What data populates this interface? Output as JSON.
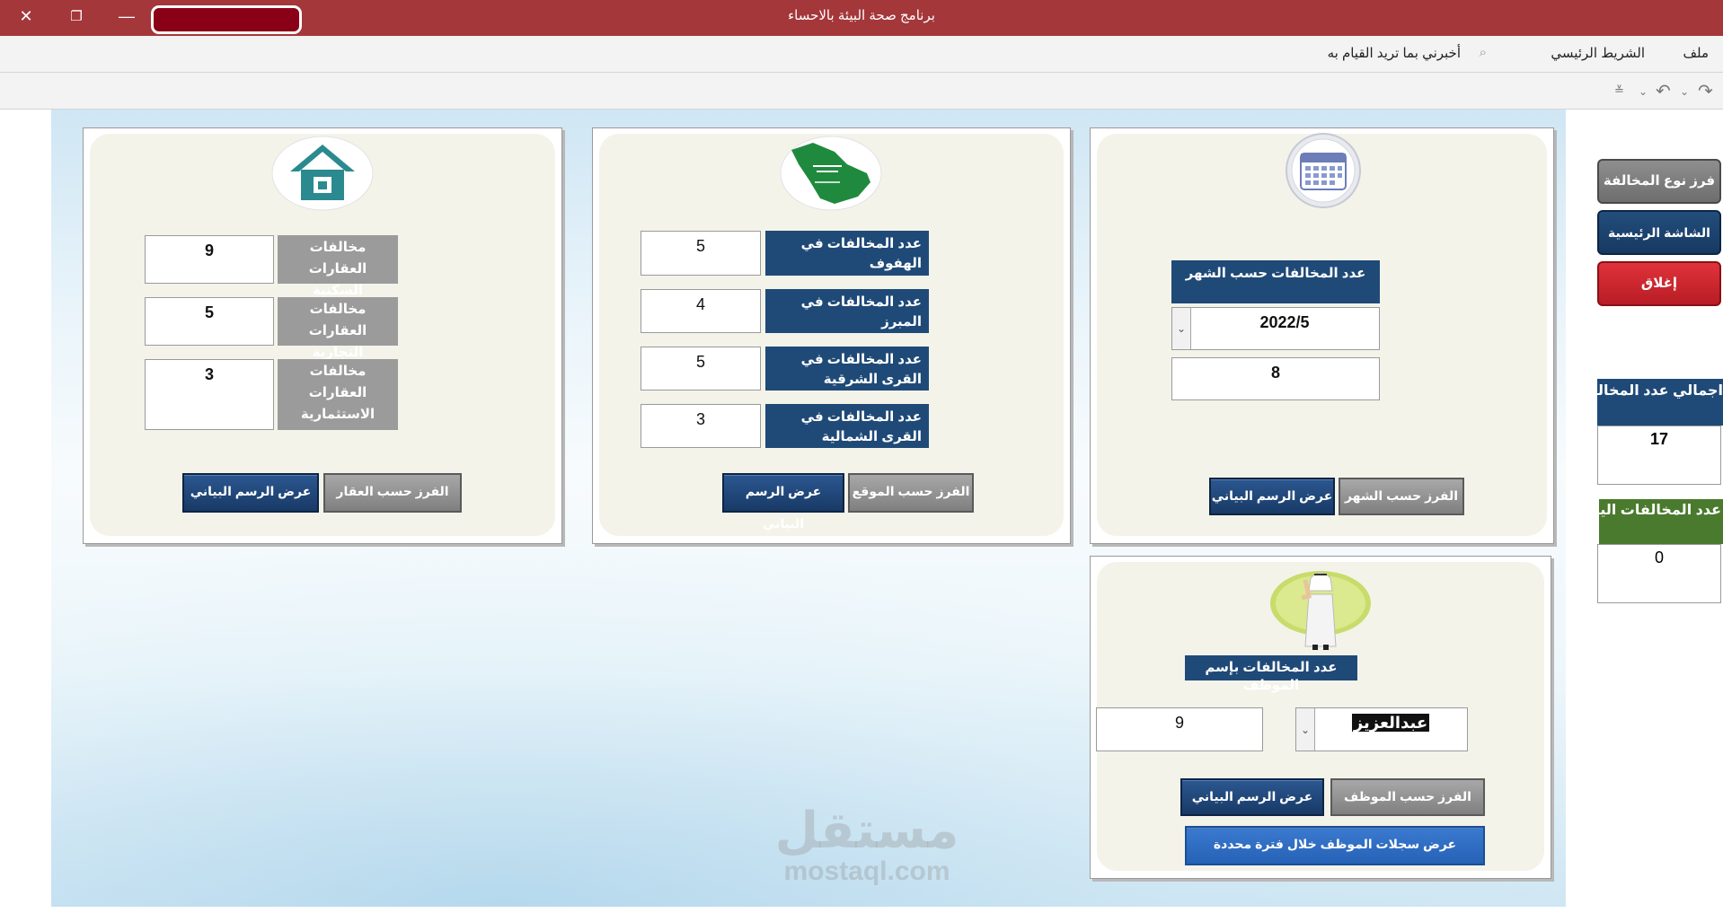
{
  "window": {
    "title": "برنامج صحة البيئة بالاحساء",
    "close_icon": "close-icon",
    "restore_icon": "restore-icon",
    "minimize_icon": "minimize-icon"
  },
  "ribbon": {
    "file": "ملف",
    "home": "الشريط الرئيسي",
    "tell_me": "أخبرني بما تريد القيام به"
  },
  "month_panel": {
    "header": "عدد المخالفات حسب الشهر",
    "month_value": "2022/5",
    "count": "8",
    "sort_button": "الفرز حسب الشهر",
    "chart_button": "عرض الرسم البياني"
  },
  "location_panel": {
    "rows": [
      {
        "label": "عدد المخالفات في الهفوف",
        "value": "5"
      },
      {
        "label": "عدد المخالفات في المبرز",
        "value": "4"
      },
      {
        "label": "عدد المخالفات في القرى الشرقية",
        "value": "5"
      },
      {
        "label": "عدد المخالفات في القرى الشمالية",
        "value": "3"
      }
    ],
    "sort_button": "الفرز حسب الموقع",
    "chart_button": "عرض الرسم البياني"
  },
  "property_panel": {
    "rows": [
      {
        "label": "مخالفات العقارات السكنية",
        "value": "9"
      },
      {
        "label": "مخالفات العقارات التجارية",
        "value": "5"
      },
      {
        "label": "مخالفات العقارات الاستثمارية",
        "value": "3"
      }
    ],
    "sort_button": "الفرز حسب العقار",
    "chart_button": "عرض الرسم البياني"
  },
  "employee_panel": {
    "header": "عدد المخالفات بإسم الموظف",
    "employee_name": "عبدالعزيز",
    "count": "9",
    "sort_button": "الفرز حسب الموظف",
    "chart_button": "عرض الرسم البياني",
    "records_button": "عرض سجلات الموظف خلال فترة محددة"
  },
  "sidebar": {
    "sort_type": "فرز نوع المخالفة",
    "home": "الشاشة الرئيسية",
    "close": "إغلاق",
    "total_label": "اجمالي عدد المخالفات",
    "total_value": "17",
    "today_label": "عدد المخالفات اليوم",
    "today_value": "0"
  },
  "watermark": {
    "arabic": "مستقل",
    "latin": "mostaql.com"
  },
  "colors": {
    "title_bar": "#a4373a",
    "navy": "#1f4a78",
    "gray_label": "#9b9b9b",
    "close_red": "#c8222a",
    "today_green": "#4a7a2e"
  }
}
